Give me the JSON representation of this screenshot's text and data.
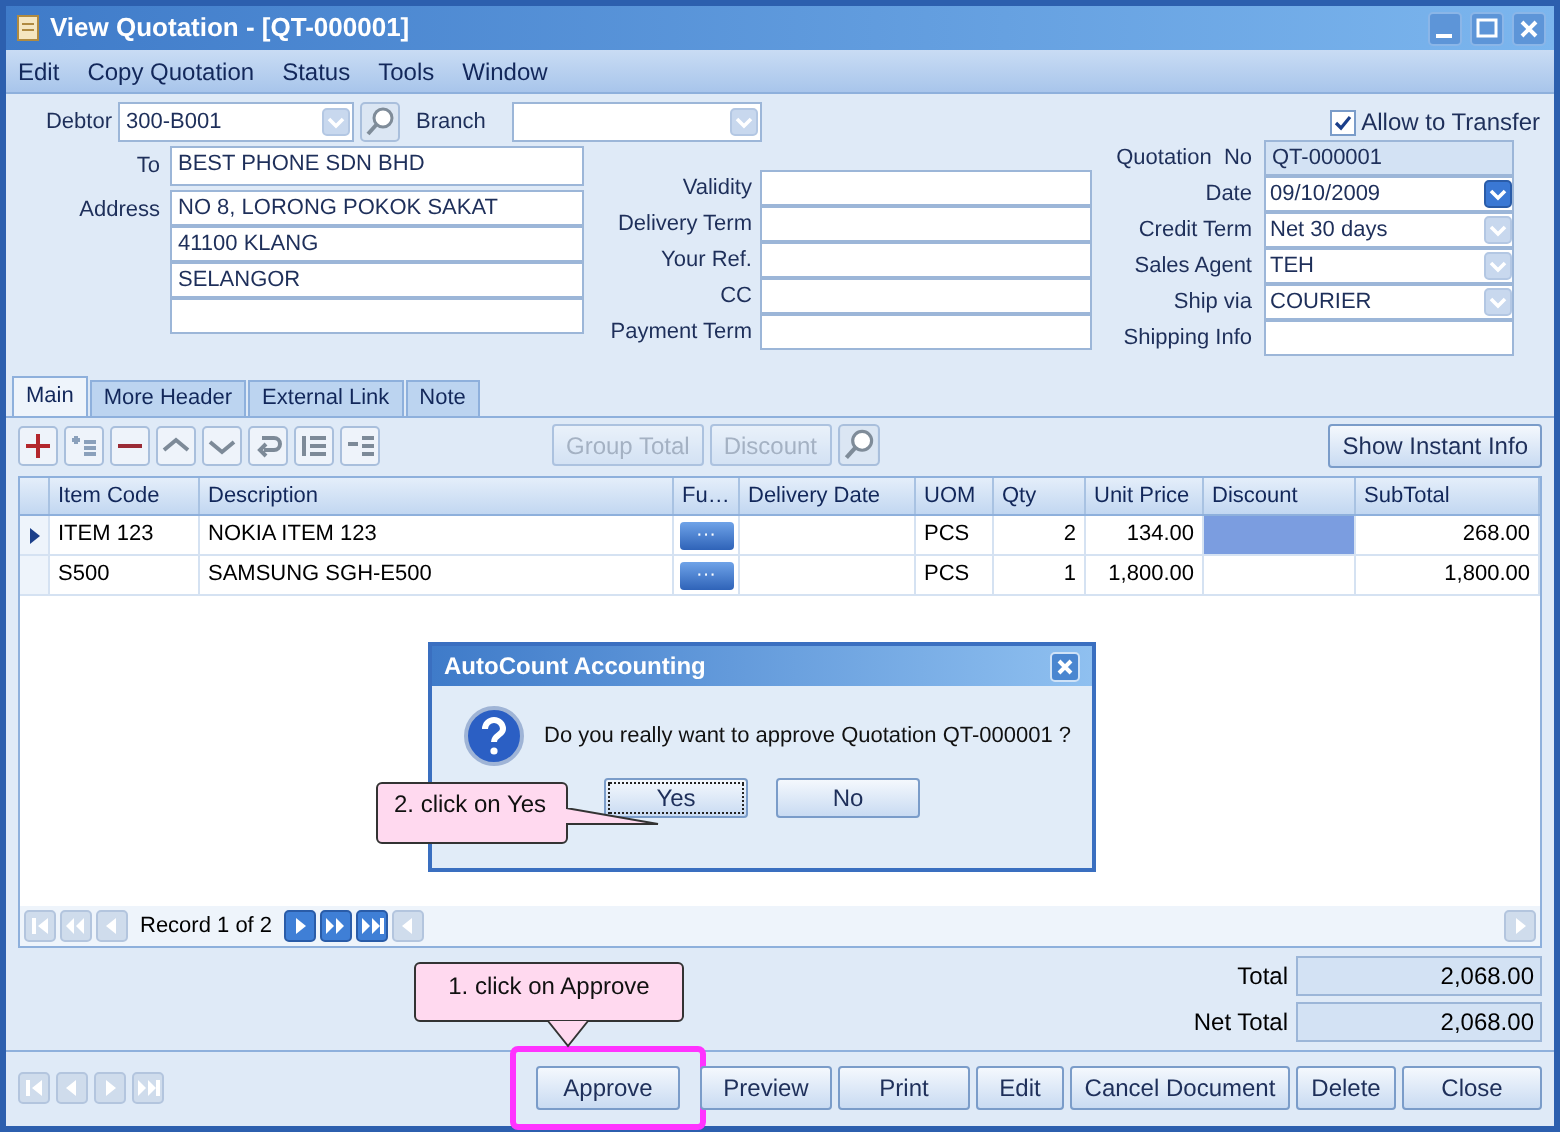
{
  "window": {
    "title": "View Quotation - [QT-000001]"
  },
  "menu": [
    "Edit",
    "Copy Quotation",
    "Status",
    "Tools",
    "Window"
  ],
  "header": {
    "debtor": {
      "label": "Debtor",
      "value": "300-B001"
    },
    "branch": {
      "label": "Branch"
    },
    "to": {
      "label": "To",
      "value": "BEST PHONE SDN BHD"
    },
    "address": {
      "label": "Address",
      "lines": [
        "NO 8, LORONG POKOK SAKAT",
        "41100 KLANG",
        "SELANGOR"
      ]
    },
    "middle_fields": [
      {
        "label": "Validity"
      },
      {
        "label": "Delivery Term"
      },
      {
        "label": "Your Ref."
      },
      {
        "label": "CC"
      },
      {
        "label": "Payment Term"
      }
    ],
    "allow_transfer": {
      "label": "Allow to Transfer",
      "checked": true
    },
    "right_fields": [
      {
        "label": "Quotation  No",
        "value": "QT-000001",
        "kind": "readonly"
      },
      {
        "label": "Date",
        "value": "09/10/2009",
        "kind": "dropdown",
        "disabled": false
      },
      {
        "label": "Credit Term",
        "value": "Net 30 days",
        "kind": "dropdown",
        "disabled": true
      },
      {
        "label": "Sales Agent",
        "value": "TEH",
        "kind": "dropdown",
        "disabled": true
      },
      {
        "label": "Ship via",
        "value": "COURIER",
        "kind": "dropdown",
        "disabled": true
      },
      {
        "label": "Shipping Info",
        "kind": "text"
      }
    ]
  },
  "tabs": [
    {
      "label": "Main",
      "selected": true
    },
    {
      "label": "More Header",
      "selected": false
    },
    {
      "label": "External Link",
      "selected": false
    },
    {
      "label": "Note",
      "selected": false
    }
  ],
  "toolbar": {
    "buttons": [
      {
        "label": "Group Total",
        "disabled": true
      },
      {
        "label": "Discount",
        "disabled": true
      }
    ],
    "instant_info": "Show Instant Info"
  },
  "table": {
    "columns": [
      "Item Code",
      "Description",
      "Fu…",
      "Delivery Date",
      "UOM",
      "Qty",
      "Unit Price",
      "Discount",
      "SubTotal"
    ],
    "rows": [
      {
        "selected": true,
        "cells": [
          "ITEM 123",
          "NOKIA ITEM 123",
          "···",
          "",
          "PCS",
          "2",
          "134.00",
          "",
          "268.00"
        ]
      },
      {
        "selected": false,
        "cells": [
          "S500",
          "SAMSUNG SGH-E500",
          "···",
          "",
          "PCS",
          "1",
          "1,800.00",
          "",
          "1,800.00"
        ]
      }
    ]
  },
  "navigator": {
    "record": "Record 1 of 2"
  },
  "totals": [
    {
      "label": "Total",
      "value": "2,068.00"
    },
    {
      "label": "Net Total",
      "value": "2,068.00"
    }
  ],
  "buttons": [
    {
      "label": "Approve",
      "highlighted": true
    },
    {
      "label": "Preview",
      "highlighted": false
    },
    {
      "label": "Print",
      "highlighted": false
    },
    {
      "label": "Edit",
      "highlighted": false
    },
    {
      "label": "Cancel Document",
      "highlighted": false
    },
    {
      "label": "Delete",
      "highlighted": false
    },
    {
      "label": "Close",
      "highlighted": false
    }
  ],
  "dialog": {
    "title": "AutoCount Accounting",
    "message": "Do you really want to approve Quotation QT-000001 ?",
    "buttons": [
      {
        "label": "Yes",
        "selected": true
      },
      {
        "label": "No",
        "selected": false
      }
    ]
  },
  "callouts": [
    {
      "text": "2. click on Yes"
    },
    {
      "text": "1. click on Approve"
    }
  ]
}
